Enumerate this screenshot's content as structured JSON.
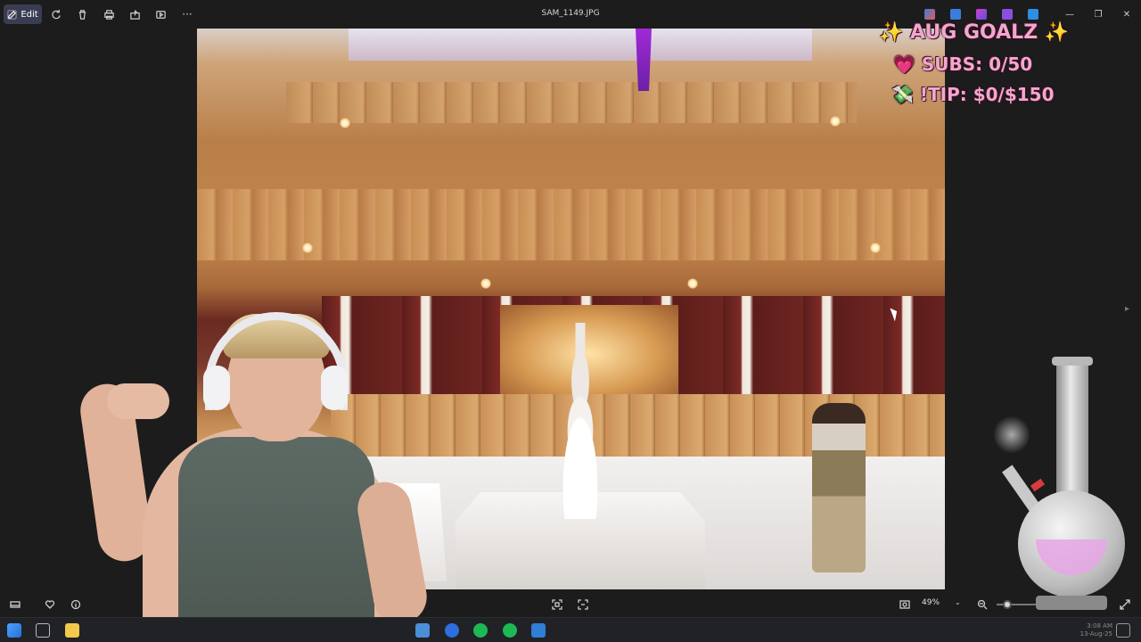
{
  "toolbar": {
    "edit_label": "Edit",
    "icons": [
      "rotate-icon",
      "delete-icon",
      "print-icon",
      "share-icon",
      "slideshow-icon",
      "more-icon"
    ],
    "more_label": "···"
  },
  "window": {
    "title": "SAM_1149.JPG",
    "minimize_glyph": "—",
    "maximize_glyph": "❐",
    "close_glyph": "✕"
  },
  "overlay": {
    "title": "✨ AUG GOALZ ✨",
    "subs": "💗 SUBS: 0/50",
    "tip": "💸 !TIP: $0/$150"
  },
  "viewer": {
    "zoom_value": "49%",
    "zoom_caret": "⌄",
    "next_arrow": "▸"
  },
  "taskbar": {
    "clock_time": "3:08 AM",
    "clock_date": "13-Aug-25"
  },
  "colors": {
    "accent": "#3a3d52",
    "goal_text": "#f4a6cf"
  }
}
